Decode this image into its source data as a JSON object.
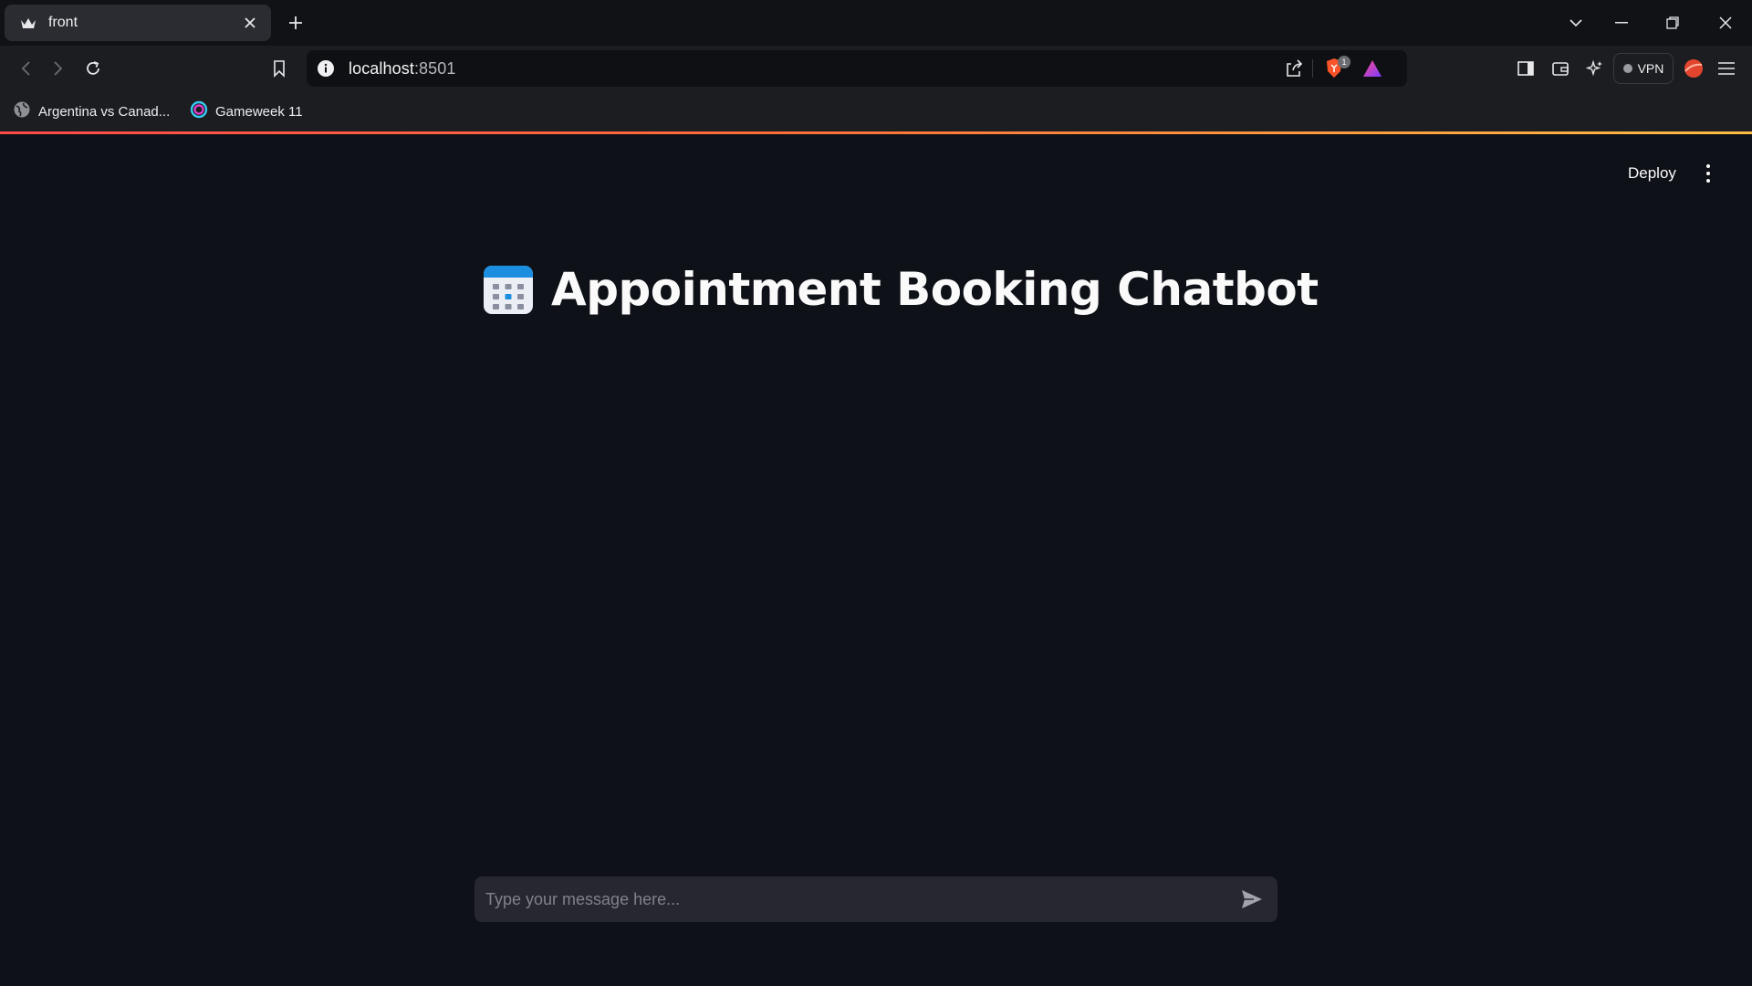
{
  "browser": {
    "tab": {
      "title": "front",
      "favicon": "crown-icon"
    },
    "address": {
      "host": "localhost",
      "port": ":8501"
    },
    "shields_badge": "1",
    "vpn_label": "VPN",
    "bookmarks": [
      {
        "label": "Argentina vs Canad...",
        "icon": "globe-icon"
      },
      {
        "label": "Gameweek 11",
        "icon": "ring-logo-icon"
      }
    ]
  },
  "app": {
    "deploy_label": "Deploy",
    "title": "Appointment Booking Chatbot",
    "title_icon": "calendar-icon",
    "chat_input": {
      "placeholder": "Type your message here...",
      "value": ""
    }
  },
  "colors": {
    "page_background": "#0e1117",
    "loading_gradient": [
      "#ff4b4b",
      "#ffbd45"
    ],
    "input_background": "#262730"
  }
}
